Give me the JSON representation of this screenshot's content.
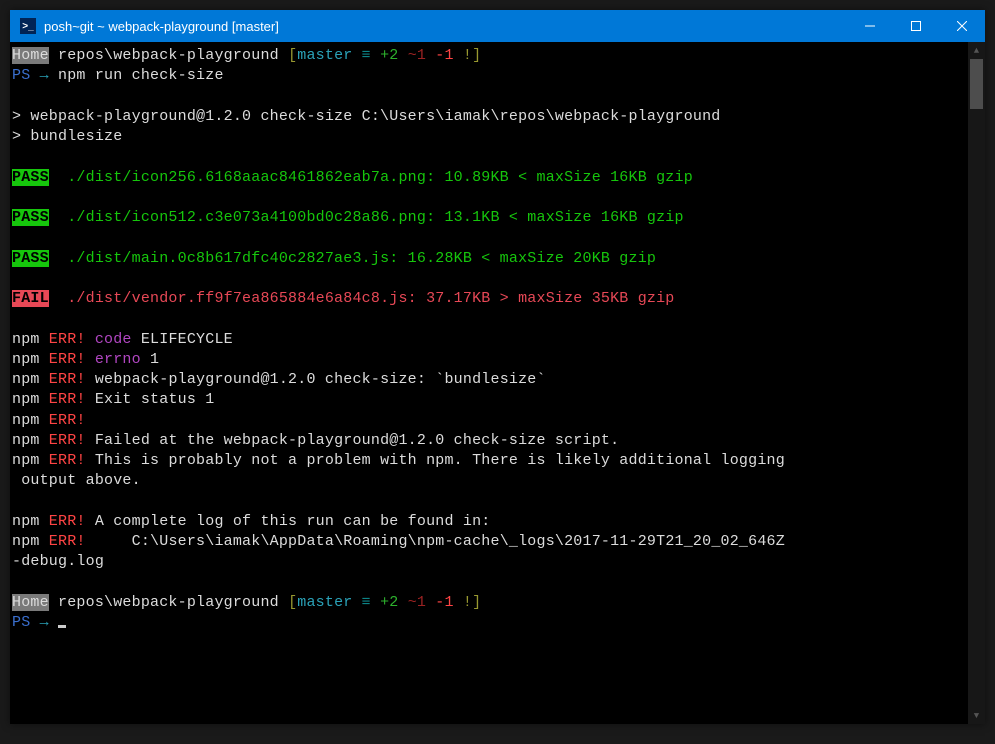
{
  "titlebar": {
    "icon_glyph": ">_",
    "title": "posh~git ~ webpack-playground [master]"
  },
  "prompt1": {
    "home": "Home",
    "path": " repos\\webpack-playground ",
    "br_open": "[",
    "branch": "master",
    "equiv": " ≡ ",
    "plus": "+2",
    "tilde": " ~1",
    "minus": " -1",
    "bang": " !",
    "br_close": "]"
  },
  "ps_line": {
    "ps": "PS",
    "arrow": " → ",
    "cmd": "npm run check-size"
  },
  "npm_header": {
    "line1": "> webpack-playground@1.2.0 check-size C:\\Users\\iamak\\repos\\webpack-playground",
    "line2": "> bundlesize"
  },
  "results": [
    {
      "status": "PASS",
      "text": "  ./dist/icon256.6168aaac8461862eab7a.png: 10.89KB < maxSize 16KB gzip"
    },
    {
      "status": "PASS",
      "text": "  ./dist/icon512.c3e073a4100bd0c28a86.png: 13.1KB < maxSize 16KB gzip"
    },
    {
      "status": "PASS",
      "text": "  ./dist/main.0c8b617dfc40c2827ae3.js: 16.28KB < maxSize 20KB gzip"
    },
    {
      "status": "FAIL",
      "text": "  ./dist/vendor.ff9f7ea865884e6a84c8.js: 37.17KB > maxSize 35KB gzip"
    }
  ],
  "errors": {
    "npm": "npm",
    "err": " ERR!",
    "code_lbl": " code",
    "code_val": " ELIFECYCLE",
    "errno_lbl": " errno",
    "errno_val": " 1",
    "line3": " webpack-playground@1.2.0 check-size: `bundlesize`",
    "line4": " Exit status 1",
    "line6": " Failed at the webpack-playground@1.2.0 check-size script.",
    "line7a": " This is probably not a problem with npm. There is likely additional logging",
    "line7b": " output above.",
    "line9": " A complete log of this run can be found in:",
    "line10": "     C:\\Users\\iamak\\AppData\\Roaming\\npm-cache\\_logs\\2017-11-29T21_20_02_646Z",
    "line10b": "-debug.log"
  },
  "ps_line2": {
    "ps": "PS",
    "arrow": " → "
  }
}
